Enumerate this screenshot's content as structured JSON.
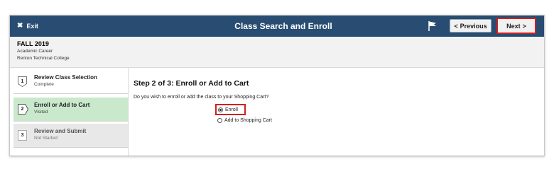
{
  "header": {
    "exit_label": "Exit",
    "title": "Class Search and Enroll",
    "previous_label": "Previous",
    "next_label": "Next",
    "bar_color": "#294d72",
    "highlight_color": "#d02020"
  },
  "career": {
    "term": "FALL 2019",
    "career_label": "Academic Career",
    "college": "Renton Technical College"
  },
  "steps": [
    {
      "number": "1",
      "name": "Review Class Selection",
      "status": "Complete"
    },
    {
      "number": "2",
      "name": "Enroll or Add to Cart",
      "status": "Visited"
    },
    {
      "number": "3",
      "name": "Review and Submit",
      "status": "Not Started"
    }
  ],
  "main": {
    "heading": "Step 2 of 3: Enroll or Add to Cart",
    "question": "Do you wish to enroll or add the class to your Shopping Cart?",
    "options": [
      {
        "label": "Enroll",
        "selected": true
      },
      {
        "label": "Add to Shopping Cart",
        "selected": false
      }
    ]
  }
}
